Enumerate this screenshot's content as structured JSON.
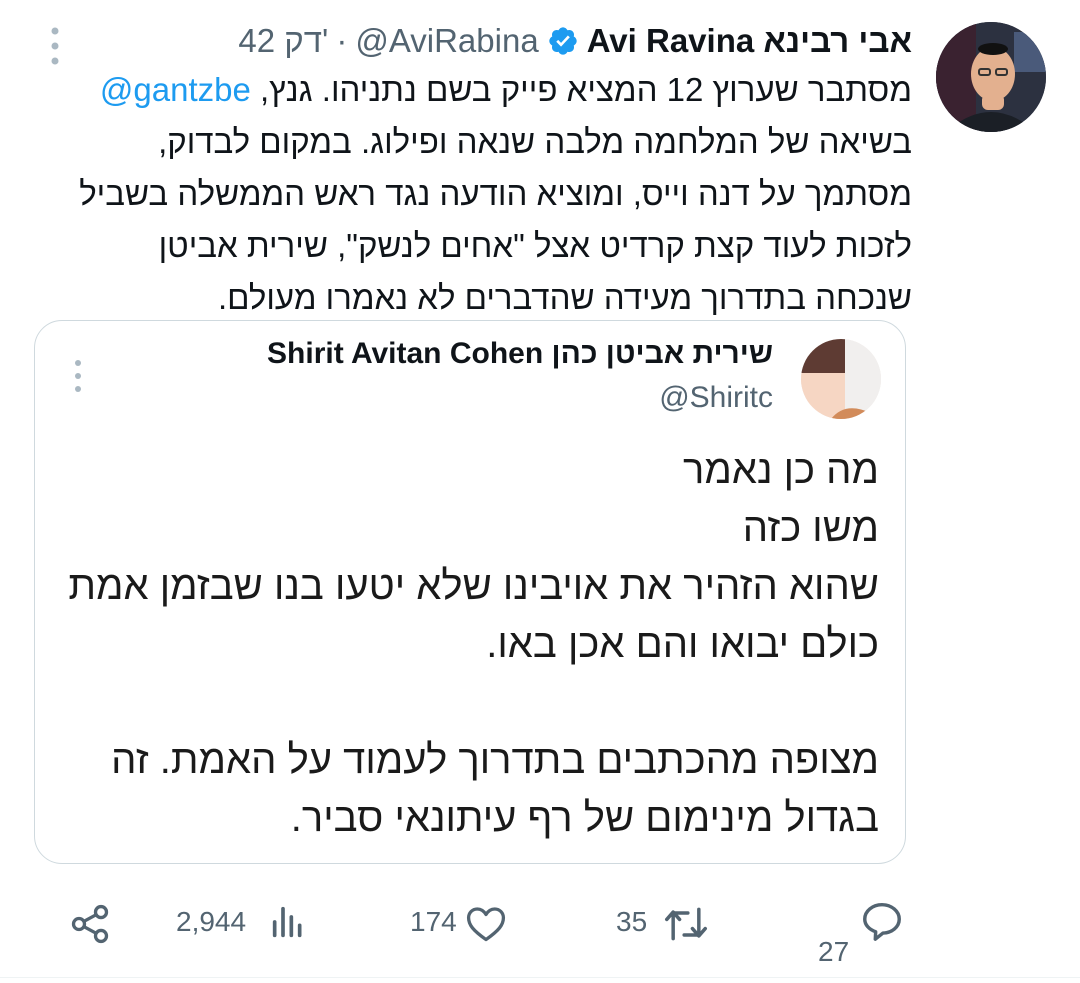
{
  "tweet": {
    "author_name": "Avi Ravina אבי רבינא",
    "handle": "@AviRabina",
    "separator": "·",
    "time": "42 דק'",
    "text_lines": [
      {
        "before": "מסתבר שערוץ 12 המציא פייק בשם נתניהו. גנץ, ",
        "mention": "@gantzbe"
      },
      {
        "before": "בשיאה של המלחמה מלבה שנאה ופילוג. במקום לבדוק,",
        "mention": ""
      },
      {
        "before": "מסתמך על דנה וייס, ומוציא הודעה נגד ראש הממשלה בשביל",
        "mention": ""
      },
      {
        "before": "לזכות לעוד קצת קרדיט אצל \"אחים לנשק\", שירית אביטן",
        "mention": ""
      },
      {
        "before": "שנכחה בתדרוך מעידה שהדברים לא נאמרו מעולם.",
        "mention": ""
      }
    ],
    "verified_icon": "verified-badge-icon",
    "more_icon": "more-vertical-icon"
  },
  "quote": {
    "author_name": "Shirit Avitan Cohen שירית אביטן כהן",
    "handle": "@Shiritc",
    "lines": [
      "מה כן נאמר",
      "משו כזה",
      "שהוא הזהיר את אויבינו שלא יטעו בנו שבזמן אמת",
      "כולם יבואו והם אכן באו.",
      "",
      "מצופה מהכתבים בתדרוך לעמוד על האמת. זה",
      "בגדול מינימום של רף עיתונאי סביר."
    ]
  },
  "actions": {
    "views": "2,944",
    "likes": "174",
    "retweets": "35",
    "replies": "27",
    "icons": [
      "share-icon",
      "views-icon",
      "like-icon",
      "retweet-icon",
      "reply-icon"
    ]
  },
  "colors": {
    "link": "#1d9bf0",
    "muted": "#536471",
    "verified": "#1d9bf0",
    "border": "#cfd9de"
  }
}
